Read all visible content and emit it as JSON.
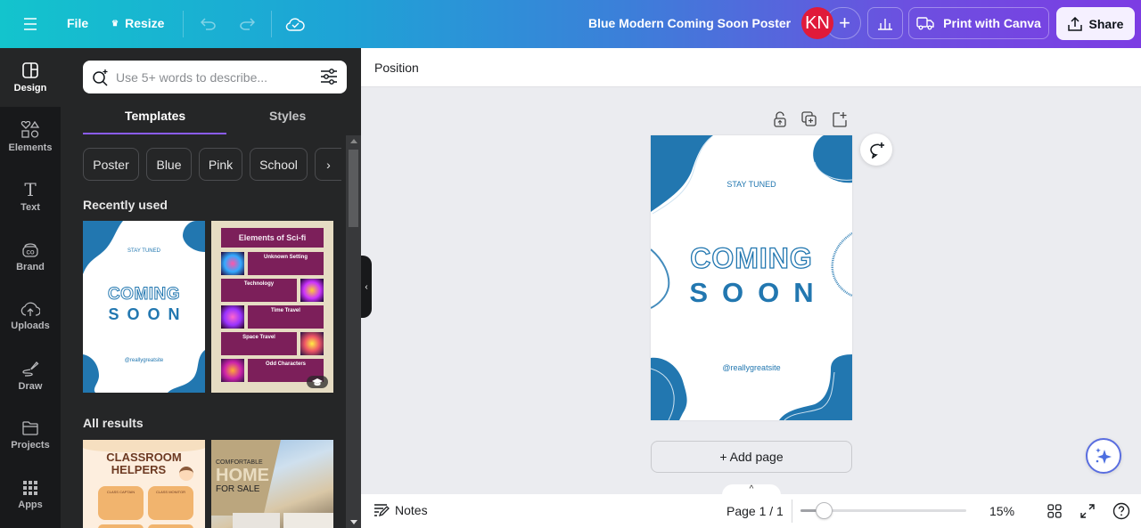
{
  "topbar": {
    "file_label": "File",
    "resize_label": "Resize",
    "doc_title": "Blue Modern Coming Soon Poster",
    "avatar_initials": "KN",
    "print_label": "Print with Canva",
    "share_label": "Share"
  },
  "rail": {
    "items": [
      {
        "label": "Design",
        "icon": "design-icon"
      },
      {
        "label": "Elements",
        "icon": "elements-icon"
      },
      {
        "label": "Text",
        "icon": "text-icon"
      },
      {
        "label": "Brand",
        "icon": "brand-icon"
      },
      {
        "label": "Uploads",
        "icon": "upload-cloud-icon"
      },
      {
        "label": "Draw",
        "icon": "draw-icon"
      },
      {
        "label": "Projects",
        "icon": "folder-icon"
      },
      {
        "label": "Apps",
        "icon": "apps-grid-icon"
      }
    ]
  },
  "panel": {
    "search_placeholder": "Use 5+ words to describe...",
    "tabs": [
      {
        "label": "Templates",
        "active": true
      },
      {
        "label": "Styles",
        "active": false
      }
    ],
    "chips": [
      "Poster",
      "Blue",
      "Pink",
      "School"
    ],
    "recently_used_heading": "Recently used",
    "all_results_heading": "All results",
    "recent_templates": [
      {
        "top_text": "STAY TUNED",
        "title_line1": "COMING",
        "title_line2": "SOON",
        "handle": "@reallygreatsite"
      },
      {
        "title": "Elements of Sci-fi",
        "sections": [
          "Unknown Setting",
          "Technology",
          "Time Travel",
          "Space Travel",
          "Odd Characters"
        ]
      }
    ],
    "result_templates": [
      {
        "title_line1": "CLASSROOM",
        "title_line2": "HELPERS",
        "box1": "CLASS CAPTAIN",
        "box2": "CLASS MONITOR"
      },
      {
        "line1": "COMFORTABLE",
        "line2": "HOME",
        "line3": "FOR SALE"
      }
    ]
  },
  "context_bar": {
    "position_label": "Position"
  },
  "canvas": {
    "stay_tuned": "STAY TUNED",
    "coming": "COMING",
    "soon": "SOON",
    "handle": "@reallygreatsite",
    "add_page_label": "+ Add page",
    "brand_blue": "#2277b0"
  },
  "footer": {
    "notes_label": "Notes",
    "page_indicator": "Page 1 / 1",
    "zoom_percent": 15,
    "zoom_label": "15%"
  }
}
